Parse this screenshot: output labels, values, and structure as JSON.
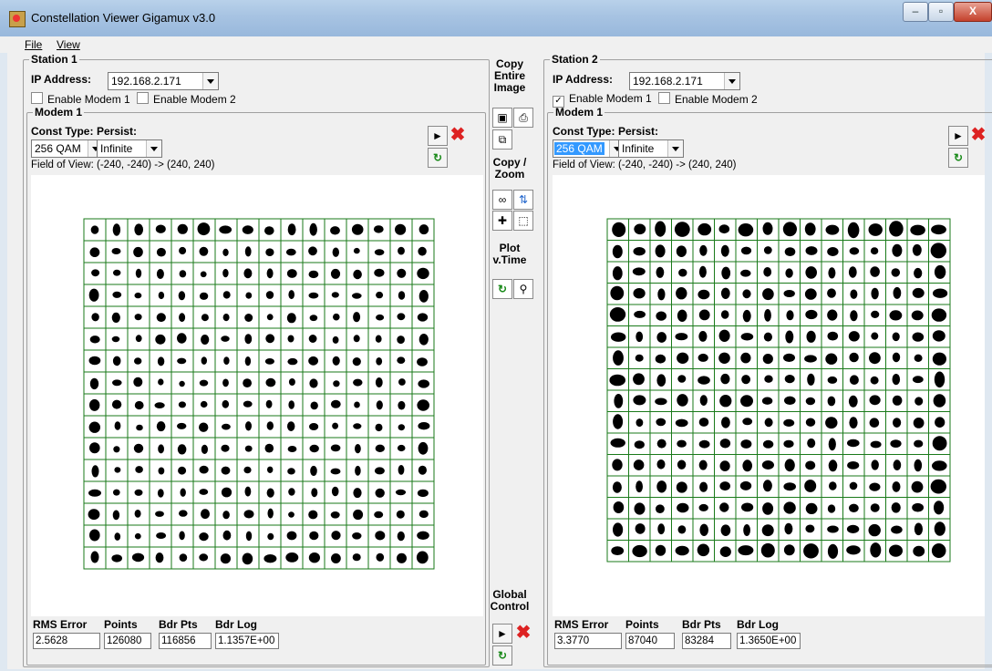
{
  "app": {
    "title": "Constellation Viewer Gigamux v3.0"
  },
  "menu": {
    "file": "File",
    "view": "View"
  },
  "window_controls": {
    "minimize": "–",
    "maximize": "▫",
    "close": "X"
  },
  "middle": {
    "copy_image": [
      "Copy",
      "Entire",
      "Image"
    ],
    "copy_zoom": [
      "Copy /",
      "Zoom"
    ],
    "plot_time": [
      "Plot",
      "v.Time"
    ],
    "global": [
      "Global",
      "Control"
    ]
  },
  "stations": [
    {
      "title": "Station 1",
      "ip_label": "IP Address:",
      "ip": "192.168.2.171",
      "enable1": {
        "label": "Enable Modem 1",
        "checked": false
      },
      "enable2": {
        "label": "Enable Modem 2",
        "checked": false
      },
      "modem": {
        "title": "Modem 1",
        "const_label": "Const Type:",
        "const_value": "256 QAM",
        "const_selected": false,
        "persist_label": "Persist:",
        "persist_value": "Infinite",
        "fov": "Field of View: (-240, -240) -> (240, 240)"
      },
      "stats": {
        "labels": [
          "RMS Error",
          "Points",
          "Bdr Pts",
          "Bdr Log"
        ],
        "values": [
          "2.5628",
          "126080",
          "116856",
          "1.1357E+00"
        ]
      }
    },
    {
      "title": "Station 2",
      "ip_label": "IP Address:",
      "ip": "192.168.2.171",
      "enable1": {
        "label": "Enable Modem 1",
        "checked": true
      },
      "enable2": {
        "label": "Enable Modem 2",
        "checked": false
      },
      "modem": {
        "title": "Modem 1",
        "const_label": "Const Type:",
        "const_value": "256 QAM",
        "const_selected": true,
        "persist_label": "Persist:",
        "persist_value": "Infinite",
        "fov": "Field of View: (-240, -240) -> (240, 240)"
      },
      "stats": {
        "labels": [
          "RMS Error",
          "Points",
          "Bdr Pts",
          "Bdr Log"
        ],
        "values": [
          "3.3770",
          "87040",
          "83284",
          "1.3650E+00"
        ]
      }
    }
  ],
  "colors": {
    "grid": "#1a7a1a",
    "dot": "#000000"
  }
}
